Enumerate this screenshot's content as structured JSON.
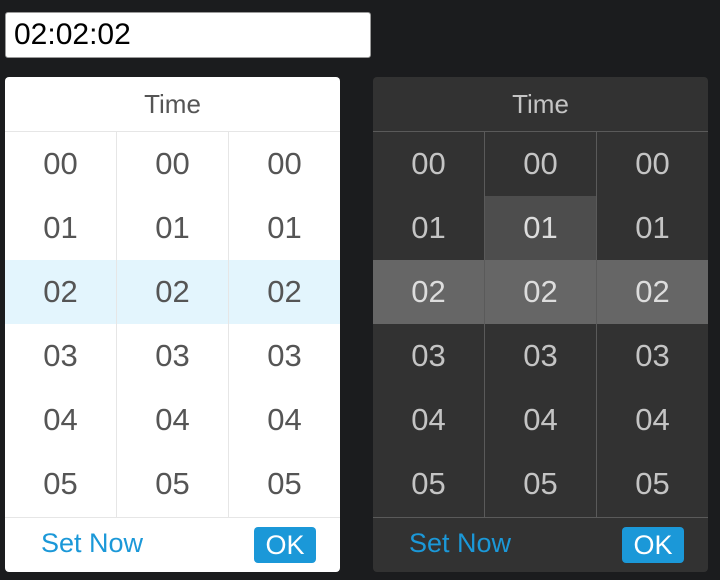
{
  "time_input": {
    "value": "02:02:02"
  },
  "colors": {
    "accent": "#1b98d8",
    "light_selected_row": "#e3f5fd",
    "dark_selected_row": "#666666",
    "dark_hover_cell": "#4d4d4d",
    "dark_panel": "#323232",
    "page_background": "#1b1c1e"
  },
  "pickers": [
    {
      "theme": "light",
      "title": "Time",
      "columns": [
        [
          "00",
          "01",
          "02",
          "03",
          "04",
          "05"
        ],
        [
          "00",
          "01",
          "02",
          "03",
          "04",
          "05"
        ],
        [
          "00",
          "01",
          "02",
          "03",
          "04",
          "05"
        ]
      ],
      "selected": [
        "02",
        "02",
        "02"
      ],
      "set_now_label": "Set Now",
      "ok_label": "OK"
    },
    {
      "theme": "dark",
      "title": "Time",
      "columns": [
        [
          "00",
          "01",
          "02",
          "03",
          "04",
          "05"
        ],
        [
          "00",
          "01",
          "02",
          "03",
          "04",
          "05"
        ],
        [
          "00",
          "01",
          "02",
          "03",
          "04",
          "05"
        ]
      ],
      "selected": [
        "02",
        "02",
        "02"
      ],
      "hovered": {
        "column": 1,
        "value": "01"
      },
      "set_now_label": "Set Now",
      "ok_label": "OK"
    }
  ]
}
